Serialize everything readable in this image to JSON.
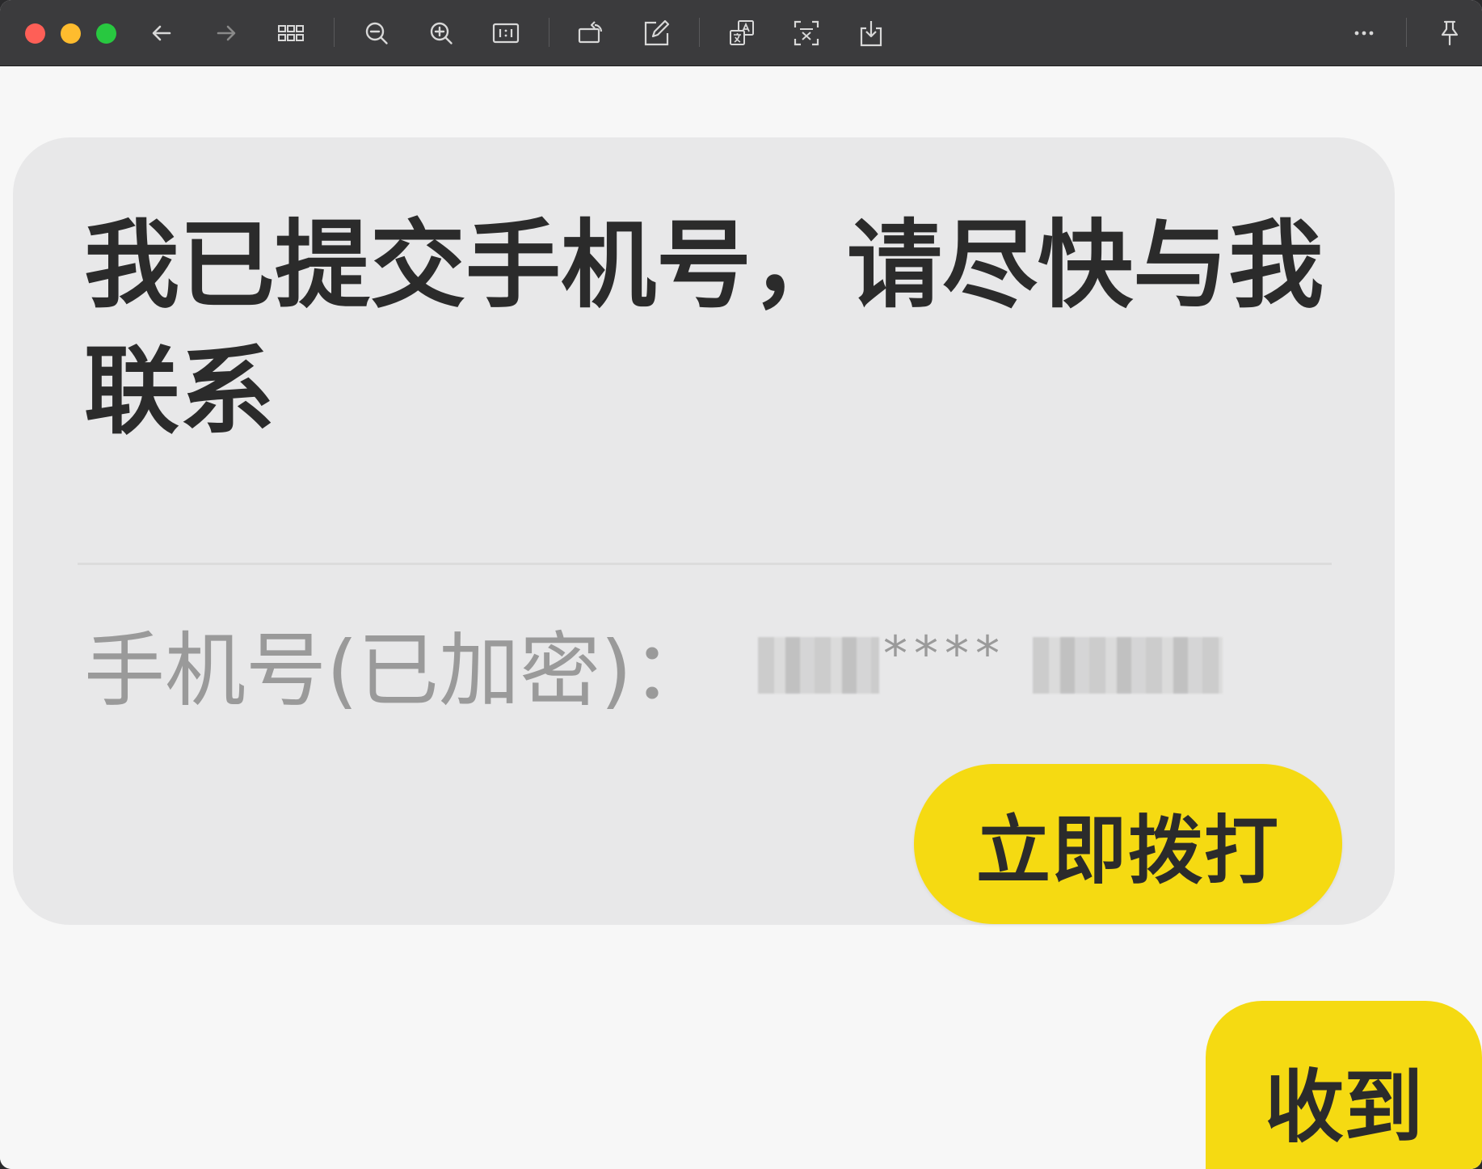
{
  "toolbar": {
    "icons": [
      "back-arrow-icon",
      "forward-arrow-icon",
      "grid-view-icon",
      "zoom-out-icon",
      "zoom-in-icon",
      "actual-size-icon",
      "rotate-icon",
      "edit-icon",
      "translate-icon",
      "ocr-scan-icon",
      "download-icon",
      "more-icon",
      "pin-icon"
    ]
  },
  "card": {
    "title": "我已提交手机号，请尽快与我联系",
    "phone_label": "手机号(已加密)：",
    "phone_masked": "****",
    "call_button_label": "立即拨打"
  },
  "received_button_label": "收到",
  "colors": {
    "toolbar_bg": "#3b3b3d",
    "card_bg": "#e8e8e9",
    "accent_yellow": "#f5da12",
    "close": "#fe5f57",
    "minimize": "#febc2e",
    "maximize": "#28c840"
  }
}
